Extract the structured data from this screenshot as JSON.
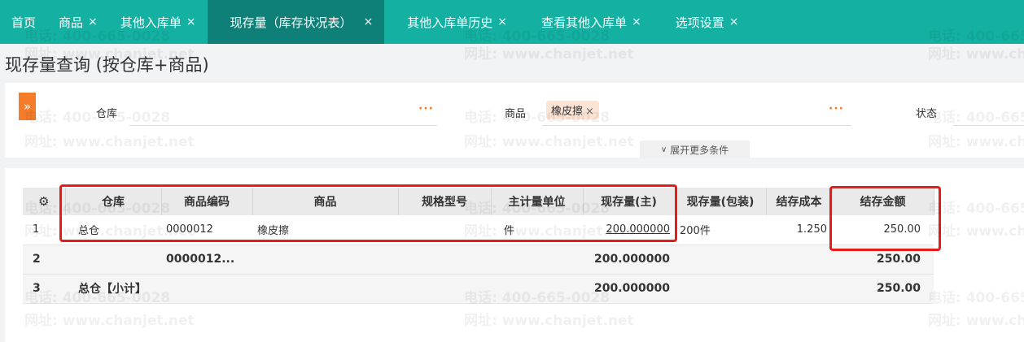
{
  "tabs": [
    {
      "label": "首页",
      "closable": false,
      "active": false
    },
    {
      "label": "商品",
      "closable": true,
      "active": false
    },
    {
      "label": "其他入库单",
      "closable": true,
      "active": false
    },
    {
      "label": "现存量（库存状况表）",
      "closable": true,
      "active": true
    },
    {
      "label": "其他入库单历史",
      "closable": true,
      "active": false
    },
    {
      "label": "查看其他入库单",
      "closable": true,
      "active": false
    },
    {
      "label": "选项设置",
      "closable": true,
      "active": false
    }
  ],
  "close_glyph": "×",
  "page_title": "现存量查询 (按仓库+商品)",
  "filters": {
    "expand_glyph": "»",
    "warehouse_label": "仓库",
    "product_label": "商品",
    "product_tag": "橡皮擦",
    "status_label": "状态",
    "more_label": "展开更多条件",
    "dots": "···"
  },
  "table": {
    "columns": [
      "仓库",
      "商品编码",
      "商品",
      "规格型号",
      "主计量单位",
      "现存量(主)",
      "现存量(包装)",
      "结存成本",
      "结存金额"
    ],
    "rows": [
      {
        "idx": "1",
        "warehouse": "总仓",
        "code": "0000012",
        "product": "橡皮擦",
        "spec": "",
        "unit": "件",
        "qty_main": "200.000000",
        "qty_pack": "200件",
        "cost": "1.250",
        "amount": "250.00"
      },
      {
        "idx": "2",
        "warehouse": "",
        "code": "0000012...",
        "product": "",
        "spec": "",
        "unit": "",
        "qty_main": "200.000000",
        "qty_pack": "",
        "cost": "",
        "amount": "250.00"
      },
      {
        "idx": "3",
        "warehouse": "总仓【小计】",
        "code": "",
        "product": "",
        "spec": "",
        "unit": "",
        "qty_main": "200.000000",
        "qty_pack": "",
        "cost": "",
        "amount": "250.00"
      }
    ]
  },
  "watermark": {
    "phone": "电话: 400-665-0028",
    "site": "网址: www.chanjet.net"
  },
  "colors": {
    "accent": "#14b1a3",
    "active_tab": "#0e8077",
    "orange": "#f57c2a",
    "highlight": "#e81a1a"
  }
}
